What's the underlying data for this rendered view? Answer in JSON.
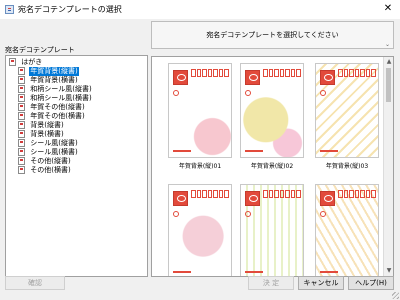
{
  "window": {
    "title": "宛名デコテンプレートの選択",
    "close_glyph": "✕"
  },
  "prompt": {
    "text": "宛名デコテンプレートを選択してください",
    "chevron": "⌄"
  },
  "tree": {
    "caption": "宛名デコテンプレート",
    "root_label": "はがき",
    "items": [
      {
        "label": "年賀背景(縦書)",
        "selected": true
      },
      {
        "label": "年賀背景(横書)",
        "selected": false
      },
      {
        "label": "和柄シール風(縦書)",
        "selected": false
      },
      {
        "label": "和柄シール風(横書)",
        "selected": false
      },
      {
        "label": "年賀その他(縦書)",
        "selected": false
      },
      {
        "label": "年賀その他(横書)",
        "selected": false
      },
      {
        "label": "背景(縦書)",
        "selected": false
      },
      {
        "label": "背景(横書)",
        "selected": false
      },
      {
        "label": "シール風(縦書)",
        "selected": false
      },
      {
        "label": "シール風(横書)",
        "selected": false
      },
      {
        "label": "その他(縦書)",
        "selected": false
      },
      {
        "label": "その他(横書)",
        "selected": false
      }
    ]
  },
  "gallery": {
    "cards": [
      {
        "caption": "年賀背景(縦)01"
      },
      {
        "caption": "年賀背景(縦)02"
      },
      {
        "caption": "年賀背景(縦)03"
      },
      {
        "caption": ""
      },
      {
        "caption": ""
      },
      {
        "caption": ""
      }
    ],
    "scroll_up": "▲",
    "scroll_down": "▼"
  },
  "buttons": {
    "confirm": "確認",
    "ok": "決 定",
    "cancel": "キャンセル",
    "help": "ヘルプ(H)"
  }
}
